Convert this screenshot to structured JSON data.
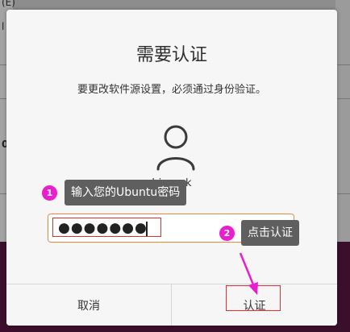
{
  "background": {
    "fragments": [
      "(E)",
      "l",
      "0"
    ]
  },
  "dialog": {
    "title": "需要认证",
    "subtitle": "要更改软件源设置，必须通过身份验证。",
    "username": "hisensk",
    "password": {
      "value": "●●●●●●●",
      "masked": true
    },
    "buttons": {
      "cancel": "取消",
      "authenticate": "认证"
    }
  },
  "annotations": {
    "step1": {
      "number": "1",
      "text": "输入您的Ubuntu密码"
    },
    "step2": {
      "number": "2",
      "text": "点击认证"
    }
  },
  "colors": {
    "focus_border": "#e9873d",
    "highlight_box": "#e03030",
    "callout_bg": "#5f5f5f",
    "badge": "#e91ecf",
    "arrow": "#e91ecf"
  },
  "icons": {
    "avatar": "user-avatar-icon",
    "reveal": "eye-icon"
  }
}
